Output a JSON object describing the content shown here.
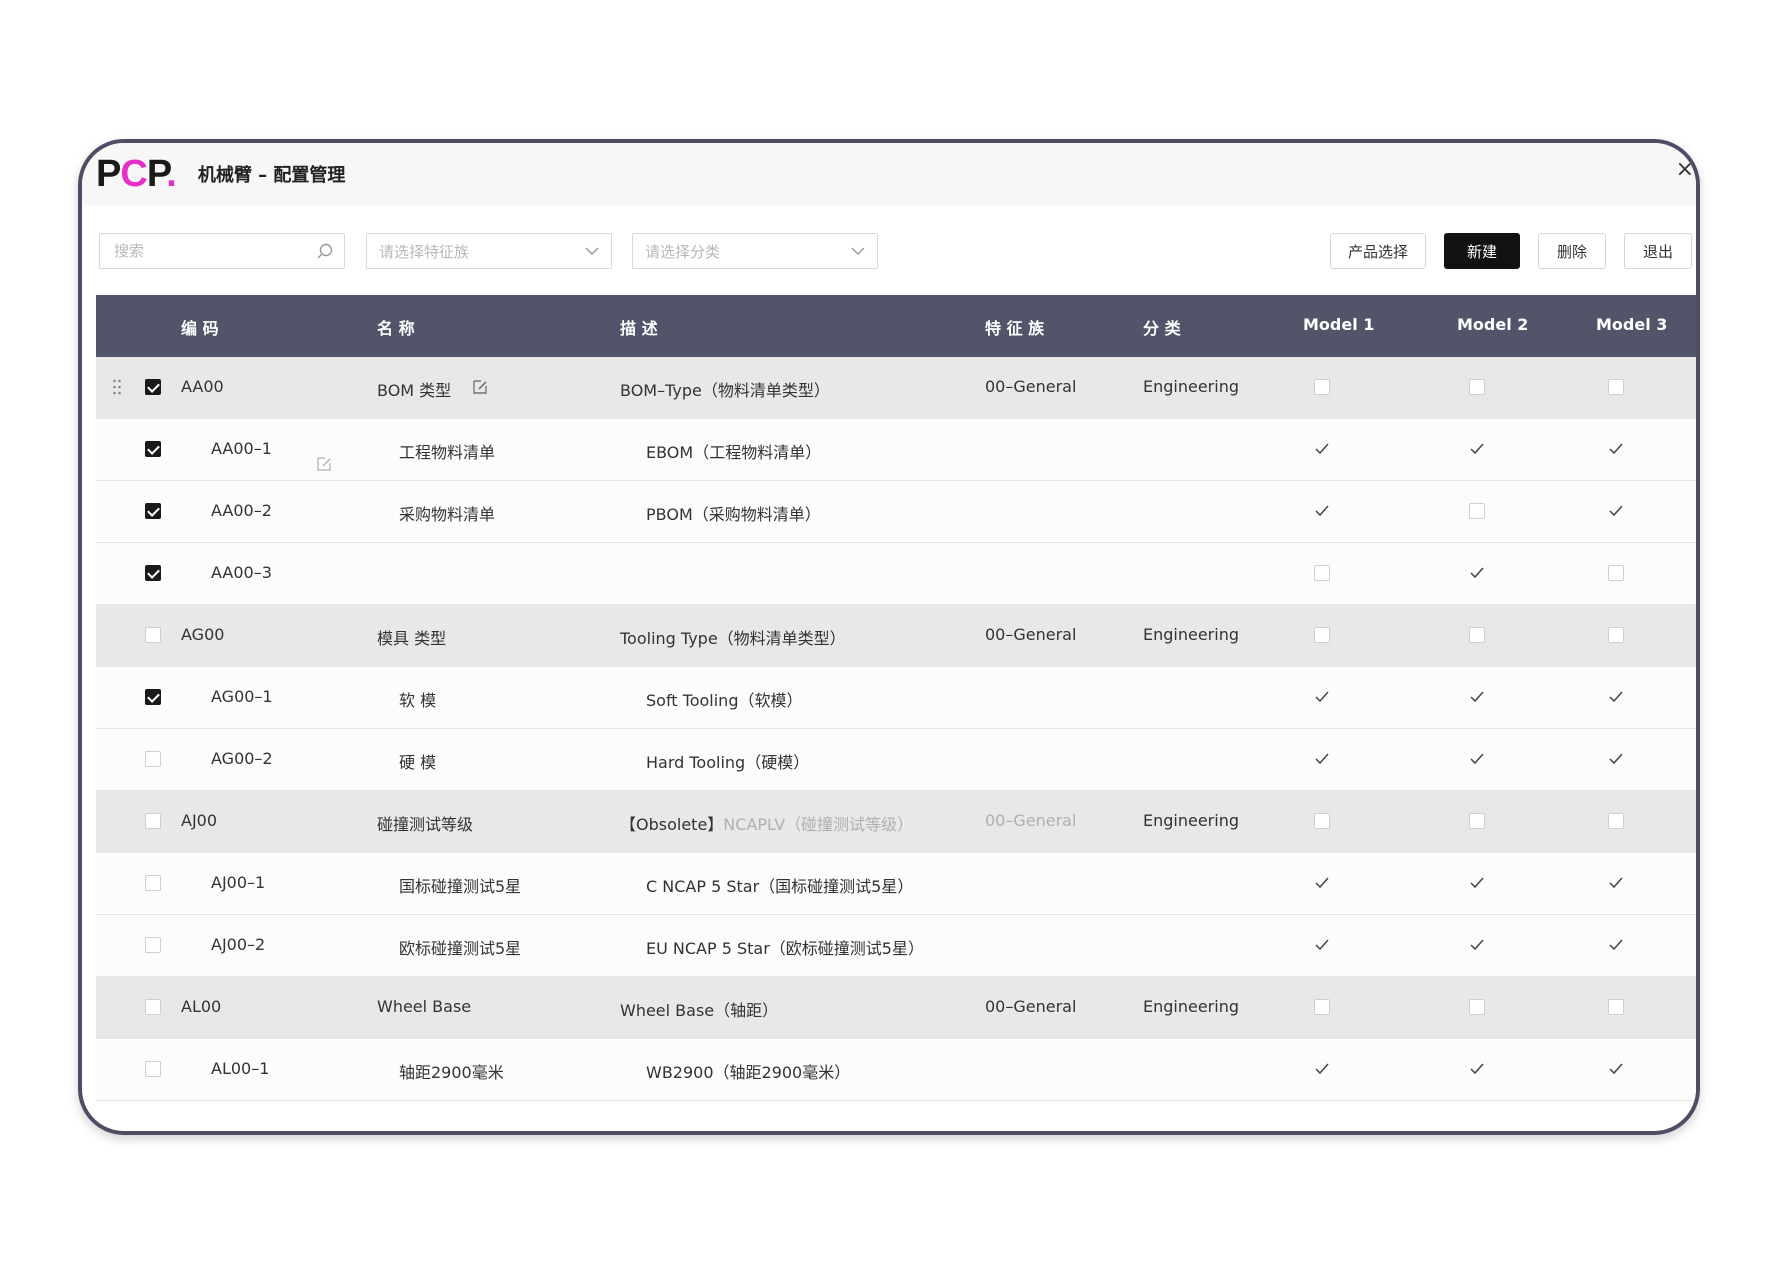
{
  "window": {
    "logo": {
      "p1": "P",
      "c": "C",
      "p2": "P",
      "dot": "."
    },
    "title": "机械臂 – 配置管理",
    "close_label": "×"
  },
  "toolbar": {
    "search_placeholder": "搜索",
    "feature_select_placeholder": "请选择特征族",
    "category_select_placeholder": "请选择分类",
    "product_button": "产品选择",
    "new_button": "新建",
    "delete_button": "删除",
    "exit_button": "退出"
  },
  "columns": {
    "code": "编 码",
    "name": "名 称",
    "desc": "描 述",
    "family": "特 征 族",
    "category": "分 类",
    "model1": "Model 1",
    "model2": "Model 2",
    "model3": "Model 3"
  },
  "rows": [
    {
      "type": "group",
      "checked": true,
      "code": "AA00",
      "name": "BOM 类型",
      "desc": "BOM–Type（物料清单类型）",
      "family": "00–General",
      "category": "Engineering",
      "models": [
        "box",
        "box",
        "box"
      ]
    },
    {
      "type": "child",
      "checked": true,
      "code": "AA00–1",
      "name": "工程物料清单",
      "desc": "EBOM（工程物料清单）",
      "family": "",
      "category": "",
      "models": [
        "tick",
        "tick",
        "tick"
      ]
    },
    {
      "type": "child",
      "checked": true,
      "code": "AA00–2",
      "name": "采购物料清单",
      "desc": "PBOM（采购物料清单）",
      "family": "",
      "category": "",
      "models": [
        "tick",
        "box",
        "tick"
      ]
    },
    {
      "type": "child",
      "checked": true,
      "code": "AA00–3",
      "name": "",
      "desc": "",
      "family": "",
      "category": "",
      "models": [
        "box",
        "tick",
        "box"
      ]
    },
    {
      "type": "group",
      "checked": false,
      "code": "AG00",
      "name": "模具 类型",
      "desc": "Tooling Type（物料清单类型）",
      "family": "00–General",
      "category": "Engineering",
      "models": [
        "box",
        "box",
        "box"
      ]
    },
    {
      "type": "child",
      "checked": true,
      "code": "AG00–1",
      "name": "软 模",
      "desc": "Soft Tooling（软模）",
      "family": "",
      "category": "",
      "models": [
        "tick",
        "tick",
        "tick"
      ]
    },
    {
      "type": "child",
      "checked": false,
      "code": "AG00–2",
      "name": "硬 模",
      "desc": "Hard Tooling（硬模）",
      "family": "",
      "category": "",
      "models": [
        "tick",
        "tick",
        "tick"
      ]
    },
    {
      "type": "group",
      "checked": false,
      "code": "AJ00",
      "name": "碰撞测试等级",
      "desc_tag": "【Obsolete】",
      "desc": "NCAPLV（碰撞测试等级）",
      "family": "00–General",
      "category": "Engineering",
      "models": [
        "box",
        "box",
        "box"
      ],
      "muted": true
    },
    {
      "type": "child",
      "checked": false,
      "code": "AJ00–1",
      "name": "国标碰撞测试5星",
      "desc": "C NCAP 5 Star（国标碰撞测试5星）",
      "family": "",
      "category": "",
      "models": [
        "tick",
        "tick",
        "tick"
      ]
    },
    {
      "type": "child",
      "checked": false,
      "code": "AJ00–2",
      "name": "欧标碰撞测试5星",
      "desc": "EU NCAP 5 Star（欧标碰撞测试5星）",
      "family": "",
      "category": "",
      "models": [
        "tick",
        "tick",
        "tick"
      ]
    },
    {
      "type": "group",
      "checked": false,
      "code": "AL00",
      "name": "Wheel Base",
      "desc": "Wheel Base（轴距）",
      "family": "00–General",
      "category": "Engineering",
      "models": [
        "box",
        "box",
        "box"
      ]
    },
    {
      "type": "child",
      "checked": false,
      "code": "AL00–1",
      "name": "轴距2900毫米",
      "desc": "WB2900（轴距2900毫米）",
      "family": "",
      "category": "",
      "models": [
        "tick",
        "tick",
        "tick"
      ]
    }
  ]
}
